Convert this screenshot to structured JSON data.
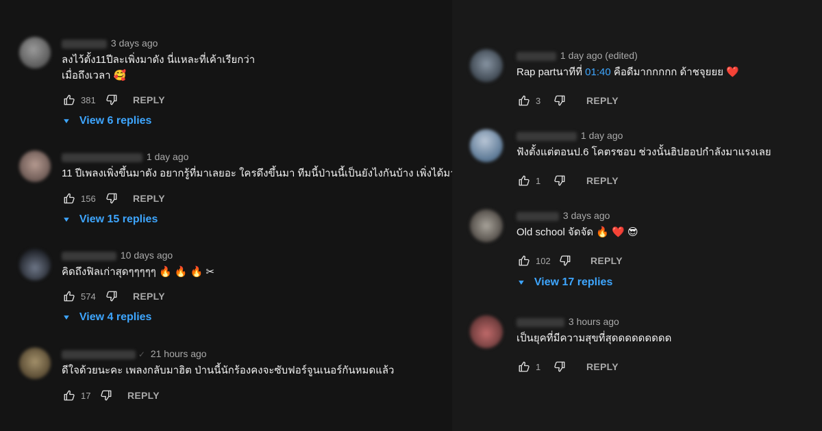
{
  "labels": {
    "reply": "REPLY"
  },
  "left_comments": [
    {
      "date": "3 days ago",
      "text_line1": "ลงไว้ตั้ง11ปีละเพิ่งมาดัง นี่แหละที่เค้าเรียกว่า",
      "text_line2": "เมื่อถึงเวลา 🥰",
      "likes": "381",
      "view_replies": "View 6 replies"
    },
    {
      "date": "1 day ago",
      "text_line1": "11 ปีเพลงเพิ่งขึ้นมาดัง อยากรู้ที่มาเลยอะ ใครดึงขึ้นมา ทีมนี้ป่านนี้เป็นยังไงกันบ้าง เพิ่งได้มา",
      "likes": "156",
      "view_replies": "View 15 replies"
    },
    {
      "date": "10 days ago",
      "text_line1": "คิดถึงฟิลเก่าสุดๆๆๆๆๆ 🔥 🔥 🔥 ✂",
      "likes": "574",
      "view_replies": "View 4 replies"
    },
    {
      "date": "21 hours ago",
      "text_line1": "ดีใจด้วยนะคะ เพลงกลับมาฮิต ป่านนี้นักร้องคงจะซับฟอร์จูนเนอร์กันหมดแล้ว",
      "likes": "17"
    }
  ],
  "right_comments": [
    {
      "date": "1 day ago (edited)",
      "text_before": "Rap partนาทีที่ ",
      "timestamp": "01:40",
      "text_after": " คือดีมากกกกก ด้าชจุยยย ❤️",
      "likes": "3"
    },
    {
      "date": "1 day ago",
      "text_line1": "ฟังตั้งแต่ตอนป.6 โคตรชอบ ช่วงนั้นฮิปฮอปกำลังมาแรงเลย",
      "likes": "1"
    },
    {
      "date": "3 days ago",
      "text_line1": "Old school จัดจัด 🔥 ❤️ 😎",
      "likes": "102",
      "view_replies": "View 17 replies"
    },
    {
      "date": "3 hours ago",
      "text_line1": "เป็นยุคที่มีความสุขที่สุดดดดดดดดด",
      "likes": "1"
    }
  ],
  "colors": {
    "background": "#141414",
    "text": "#f1f1f1",
    "secondary_text": "#aaaaaa",
    "link_blue": "#3ea6ff"
  },
  "icons": [
    "thumb-up-icon",
    "thumb-down-icon",
    "caret-down-icon",
    "check-verified-icon"
  ]
}
